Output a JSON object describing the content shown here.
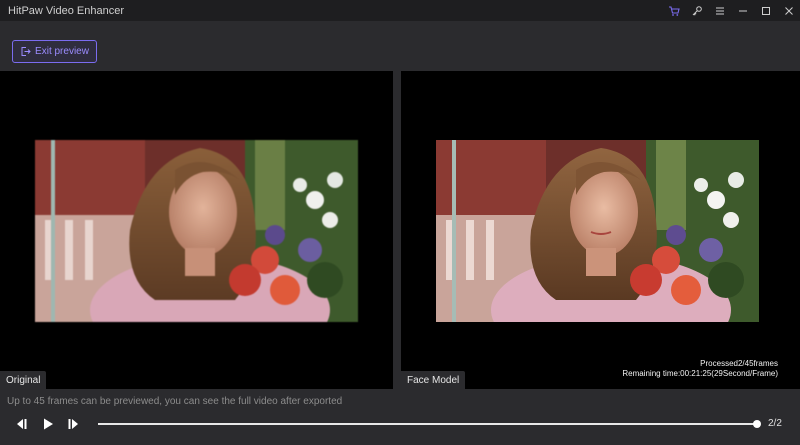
{
  "window": {
    "title": "HitPaw Video Enhancer",
    "controls": [
      "cart-icon",
      "key-icon",
      "menu-icon",
      "minimize-icon",
      "maximize-icon",
      "close-icon"
    ],
    "accent_color": "#7b6cf0"
  },
  "toolbar": {
    "exit_label": "Exit preview"
  },
  "panels": {
    "original_label": "Original",
    "processed_label": "Face Model",
    "processed_info": "Processed2/45frames",
    "remaining_info": "Remaining time:00:21:25(29Second/Frame)"
  },
  "footer": {
    "notice": "Up to 45 frames can be previewed, you can see the full video after exported",
    "counter": "2/2",
    "progress_fraction": 1.0
  }
}
